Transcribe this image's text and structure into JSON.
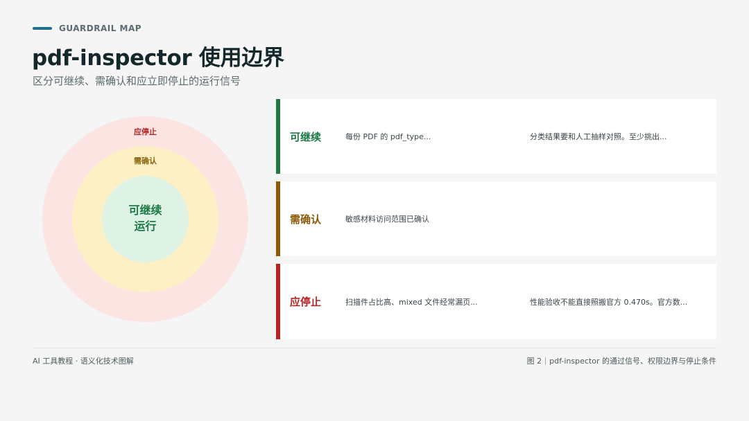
{
  "header": {
    "eyebrow": "GUARDRAIL MAP",
    "title": "pdf-inspector 使用边界",
    "subtitle": "区分可继续、需确认和应立即停止的运行信号"
  },
  "rings": {
    "outer_label": "应停止",
    "middle_label": "需确认",
    "inner_line1": "可继续",
    "inner_line2": "运行"
  },
  "rows": [
    {
      "name": "可继续",
      "color": "#1d7a45",
      "col1": "每份 PDF 的 pdf_type...",
      "col2": "分类结果要和人工抽样对照。至少挑出..."
    },
    {
      "name": "需确认",
      "color": "#8a5a0a",
      "col1": "敏感材料访问范围已确认",
      "col2": ""
    },
    {
      "name": "应停止",
      "color": "#b32626",
      "col1": "扫描件占比高、mixed 文件经常漏页...",
      "col2": "性能验收不能直接照搬官方 0.470s。官方数..."
    }
  ],
  "footer": {
    "left": "AI 工具教程 · 语义化技术图解",
    "right": "图 2｜pdf-inspector 的通过信号、权限边界与停止条件"
  },
  "colors": {
    "accent": "#1d6f8f",
    "go": "#1d7a45",
    "confirm": "#8a5a0a",
    "stop": "#b32626"
  }
}
